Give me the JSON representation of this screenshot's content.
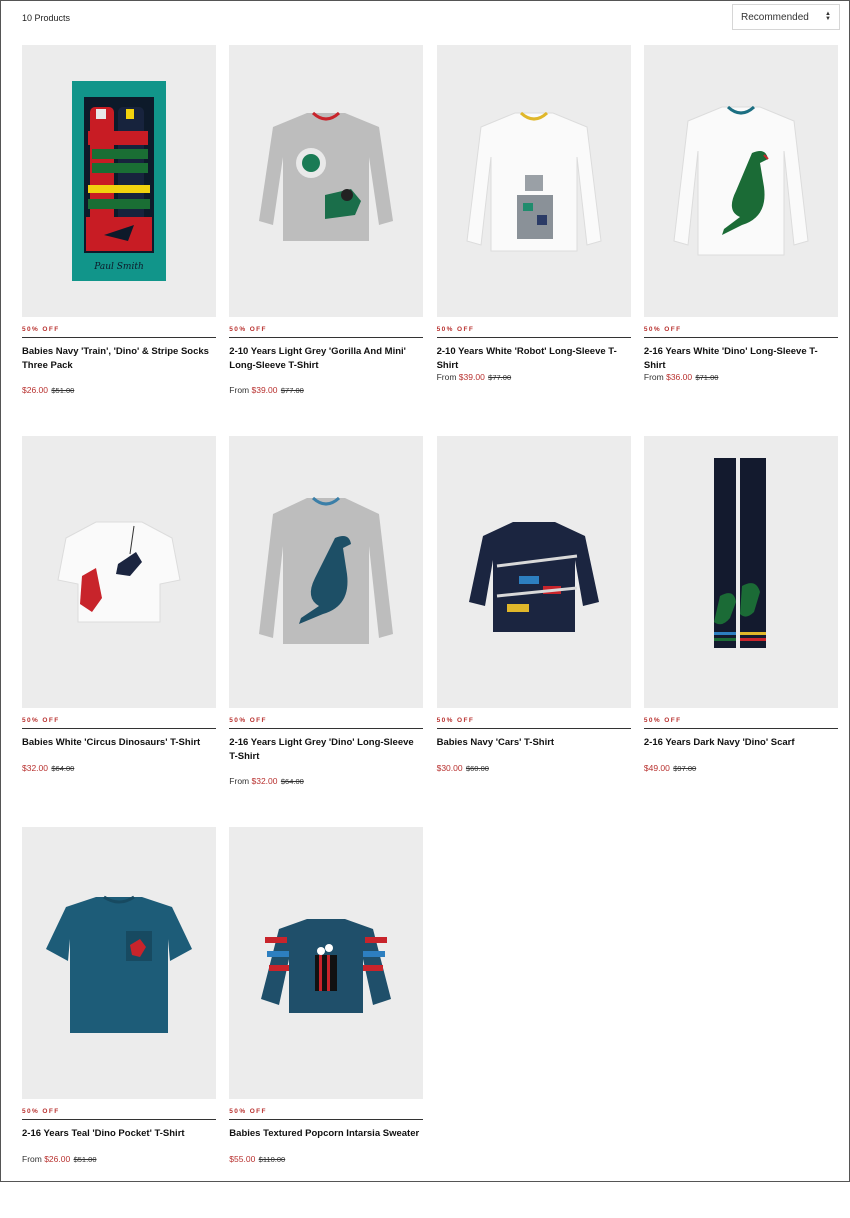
{
  "toolbar": {
    "count_label": "10 Products",
    "sort": {
      "selected": "Recommended"
    }
  },
  "colors": {
    "accent": "#b8312f",
    "tile": "#ececec"
  },
  "products": [
    {
      "badge": "50% OFF",
      "name": "Babies Navy 'Train', 'Dino' & Stripe Socks Three Pack",
      "from": "",
      "price": "$26.00",
      "was": "$51.00",
      "image": "socks-box"
    },
    {
      "badge": "50% OFF",
      "name": "2-10 Years Light Grey 'Gorilla And Mini' Long-Sleeve T-Shirt",
      "from": "From ",
      "price": "$39.00",
      "was": "$77.00",
      "image": "grey-longsleeve-gorilla"
    },
    {
      "badge": "50% OFF",
      "name": "2-10 Years White 'Robot' Long-Sleeve T-Shirt",
      "from": "From ",
      "price": "$39.00",
      "was": "$77.00",
      "image": "white-longsleeve-robot"
    },
    {
      "badge": "50% OFF",
      "name": "2-16 Years White 'Dino' Long-Sleeve T-Shirt",
      "from": "From ",
      "price": "$36.00",
      "was": "$71.00",
      "image": "white-longsleeve-dino"
    },
    {
      "badge": "50% OFF",
      "name": "Babies White 'Circus Dinosaurs' T-Shirt",
      "from": "",
      "price": "$32.00",
      "was": "$64.00",
      "image": "white-tee-circus"
    },
    {
      "badge": "50% OFF",
      "name": "2-16 Years Light Grey 'Dino' Long-Sleeve T-Shirt",
      "from": "From ",
      "price": "$32.00",
      "was": "$64.00",
      "image": "grey-longsleeve-dino"
    },
    {
      "badge": "50% OFF",
      "name": "Babies Navy 'Cars' T-Shirt",
      "from": "",
      "price": "$30.00",
      "was": "$60.00",
      "image": "navy-tee-cars"
    },
    {
      "badge": "50% OFF",
      "name": "2-16 Years Dark Navy 'Dino' Scarf",
      "from": "",
      "price": "$49.00",
      "was": "$97.00",
      "image": "navy-scarf-dino"
    },
    {
      "badge": "50% OFF",
      "name": "2-16 Years Teal 'Dino Pocket' T-Shirt",
      "from": "From ",
      "price": "$26.00",
      "was": "$51.00",
      "image": "teal-tee-pocket"
    },
    {
      "badge": "50% OFF",
      "name": "Babies Textured Popcorn Intarsia Sweater",
      "from": "",
      "price": "$55.00",
      "was": "$110.00",
      "image": "popcorn-sweater"
    }
  ]
}
